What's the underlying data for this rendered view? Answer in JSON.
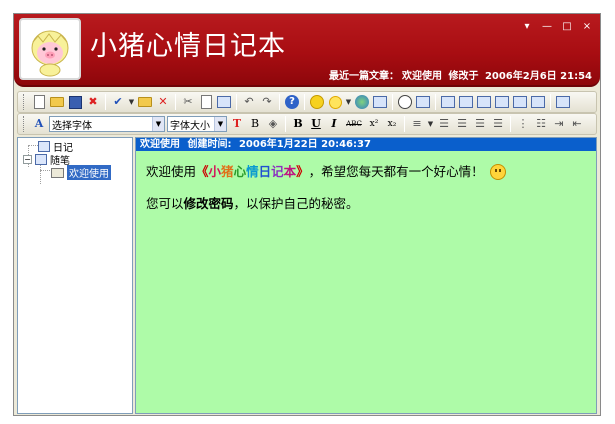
{
  "window": {
    "title": "小猪心情日记本",
    "controls": [
      "▾",
      "—",
      "□",
      "×"
    ]
  },
  "header": {
    "latest_label": "最近一篇文章：",
    "latest_title": "欢迎使用",
    "modified_label": "修改于",
    "modified_time": "2006年2月6日 21:54"
  },
  "toolbar": {
    "font_select_value": "选择字体",
    "size_select_value": "字体大小",
    "bold": "B",
    "italic": "I",
    "underline": "U",
    "strike": "ABC",
    "superscript": "x²",
    "subscript": "x₂"
  },
  "tree": {
    "diary": "日记",
    "notes": "随笔",
    "welcome": "欢迎使用"
  },
  "entry": {
    "title": "欢迎使用",
    "created_label": "创建时间:",
    "created_time": "2006年1月22日 20:46:37",
    "greeting": "欢迎使用",
    "open_quote": "《",
    "app_name_chars": [
      "小",
      "猪",
      "心",
      "情",
      "日",
      "记",
      "本"
    ],
    "close_quote": "》",
    "greeting_rest": "，希望您每天都有一个好心情！",
    "line2_before": "您可以",
    "line2_bold": "修改密码",
    "line2_after": "，以保护自己的秘密。"
  },
  "colors": {
    "header_red": "#a80d12",
    "editor_bg": "#aefba8",
    "entry_header_blue": "#0a5fcc",
    "quote_color": "#cc0000",
    "title_colors": [
      "#d4145a",
      "#e0701a",
      "#2a9a2a",
      "#0a9ad0",
      "#2050d0",
      "#8a30c0",
      "#c01080"
    ]
  },
  "icons": [
    "new-doc-icon",
    "open-folder-icon",
    "save-icon",
    "delete-icon",
    "cut-icon",
    "copy-icon",
    "paste-icon",
    "undo-icon",
    "redo-icon",
    "help-icon",
    "smiley-icon",
    "weather-icon",
    "globe-icon",
    "clock-icon"
  ]
}
